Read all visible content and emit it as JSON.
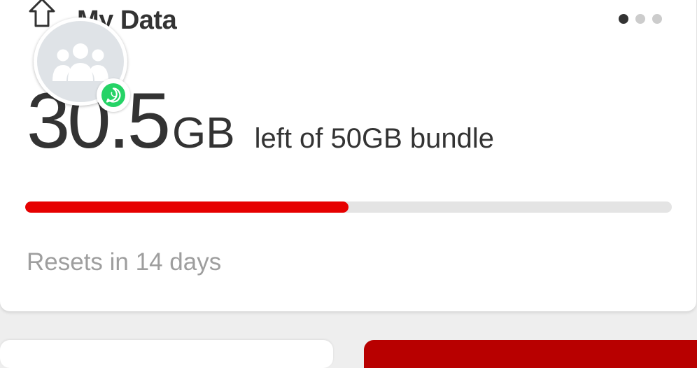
{
  "card": {
    "title": "My Data",
    "remaining_value": "30.5",
    "remaining_unit": "GB",
    "remaining_label": "left of 50GB bundle",
    "used_fraction": 0.5,
    "reset_text": "Resets in 14 days",
    "carousel_active_index": 0,
    "carousel_count": 3
  },
  "icons": {
    "home": "home-icon",
    "avatar": "group-avatar-icon",
    "whatsapp": "whatsapp-icon"
  },
  "colors": {
    "accent": "#e60000",
    "progress_track": "#e4e4e4",
    "text": "#333333",
    "muted_text": "#9e9e9e",
    "whatsapp_green": "#25d366",
    "tile_red": "#b80000"
  }
}
